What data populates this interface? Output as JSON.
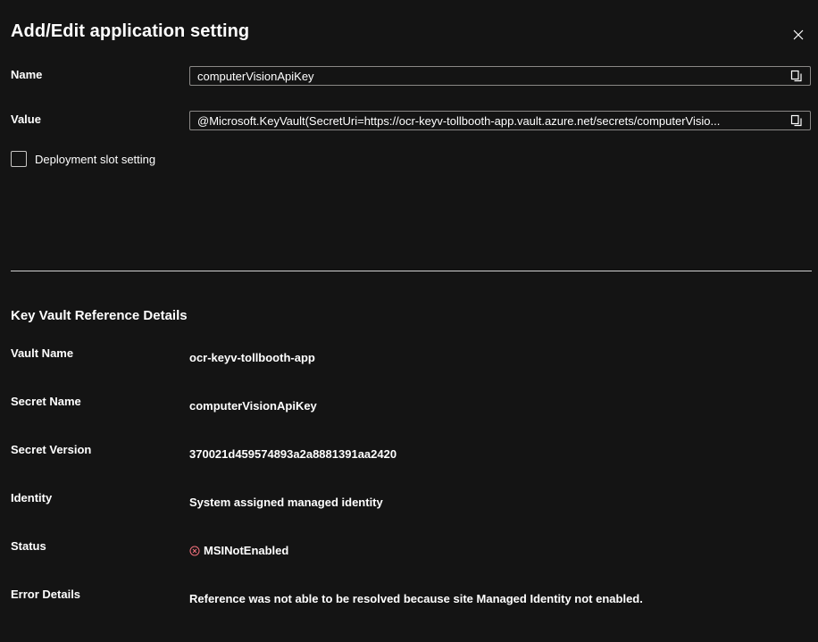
{
  "dialog": {
    "title": "Add/Edit application setting"
  },
  "form": {
    "name_label": "Name",
    "name_value": "computerVisionApiKey",
    "value_label": "Value",
    "value_value": "@Microsoft.KeyVault(SecretUri=https://ocr-keyv-tollbooth-app.vault.azure.net/secrets/computerVisio...",
    "deployment_slot_label": "Deployment slot setting",
    "deployment_slot_checked": false
  },
  "key_vault": {
    "section_title": "Key Vault Reference Details",
    "rows": [
      {
        "label": "Vault Name",
        "value": "ocr-keyv-tollbooth-app"
      },
      {
        "label": "Secret Name",
        "value": "computerVisionApiKey"
      },
      {
        "label": "Secret Version",
        "value": "370021d459574893a2a8881391aa2420"
      },
      {
        "label": "Identity",
        "value": "System assigned managed identity"
      },
      {
        "label": "Status",
        "value": "MSINotEnabled"
      },
      {
        "label": "Error Details",
        "value": "Reference was not able to be resolved because site Managed Identity not enabled."
      }
    ]
  },
  "icons": {
    "close": "close-icon",
    "copy": "copy-icon",
    "status_error": "error-circle-icon"
  },
  "colors": {
    "background": "#141414",
    "error": "#f1707b",
    "border": "#8a8886"
  }
}
